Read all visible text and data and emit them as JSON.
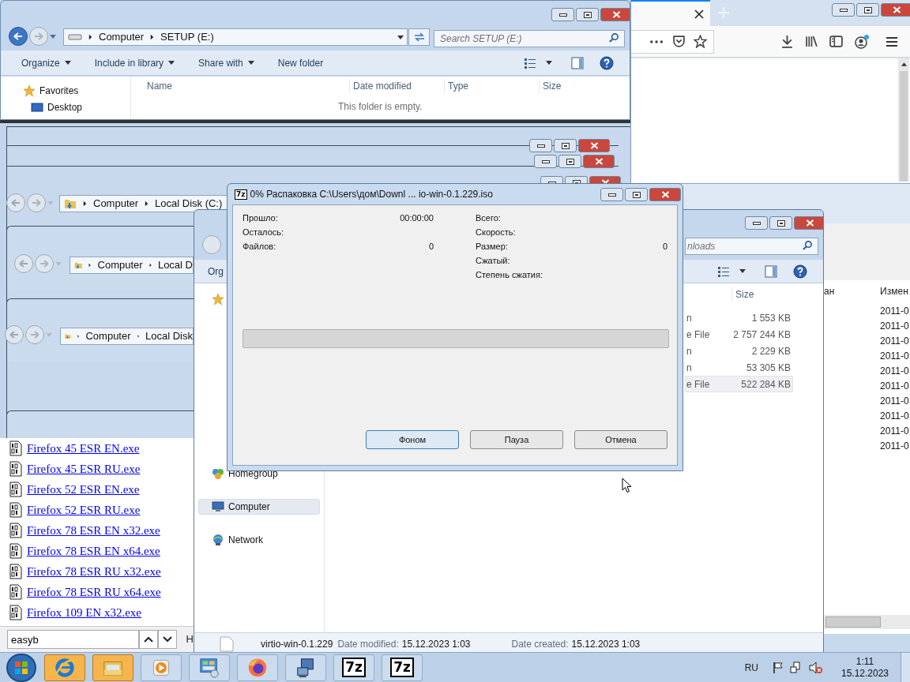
{
  "explorer_setup": {
    "address": [
      "Computer",
      "SETUP (E:)"
    ],
    "search_placeholder": "Search SETUP (E:)",
    "toolbar": [
      "Organize",
      "Include in library",
      "Share with",
      "New folder"
    ],
    "nav": [
      {
        "label": "Favorites",
        "kind": "favorites"
      },
      {
        "label": "Desktop",
        "kind": "desktop"
      }
    ],
    "columns": [
      "Name",
      "Date modified",
      "Type",
      "Size"
    ],
    "empty_message": "This folder is empty."
  },
  "ghost_windows": [
    {
      "address": [
        "Computer",
        "Local Disk (C:)"
      ]
    },
    {
      "address": [
        "Computer",
        "Local D"
      ]
    },
    {
      "address": [
        "Computer",
        "Local Disk"
      ]
    }
  ],
  "back_window": {
    "columns": [
      "ан",
      "Измен"
    ],
    "rows": [
      "2011-0",
      "2011-0",
      "2011-0",
      "2011-0",
      "2011-0",
      "2011-0",
      "2011-0",
      "2011-0",
      "2011-0",
      "2011-0"
    ]
  },
  "browser_page": {
    "links": [
      "Firefox 45 ESR EN.exe",
      "Firefox 45 ESR RU.exe",
      "Firefox 52 ESR EN.exe",
      "Firefox 52 ESR RU.exe",
      "Firefox 78 ESR EN x32.exe",
      "Firefox 78 ESR EN x64.exe",
      "Firefox 78 ESR RU x32.exe",
      "Firefox 78 ESR RU x64.exe",
      "Firefox 109 EN x32.exe"
    ],
    "find_value": "easyb",
    "column_2": "H"
  },
  "explorer_downloads": {
    "search_placeholder": "nloads",
    "toolbar": [
      "Org"
    ],
    "nav": [
      {
        "label": "Homegroup",
        "kind": "homegroup",
        "selected": false
      },
      {
        "label": "Computer",
        "kind": "computer",
        "selected": true
      },
      {
        "label": "Network",
        "kind": "network",
        "selected": false
      }
    ],
    "columns": [
      "Size"
    ],
    "rows": [
      {
        "type": "n",
        "size": "1 553 KB",
        "selected": false
      },
      {
        "type": "e File",
        "size": "2 757 244 KB",
        "selected": false
      },
      {
        "type": "n",
        "size": "2 229 KB",
        "selected": false
      },
      {
        "type": "n",
        "size": "53 305 KB",
        "selected": false
      },
      {
        "type": "e File",
        "size": "522 284 KB",
        "selected": true
      }
    ],
    "status": {
      "name": "virtio-win-0.1.229",
      "modified_label": "Date modified:",
      "modified": "15.12.2023 1:03",
      "created_label": "Date created:",
      "created": "15.12.2023 1:03"
    }
  },
  "dialog": {
    "icon_text": "7z",
    "title": "0% Распаковка C:\\Users\\дом\\Downl ... io-win-0.1.229.iso",
    "left_stats": [
      {
        "label": "Прошло:",
        "value": "00:00:00"
      },
      {
        "label": "Осталось:"
      },
      {
        "label": "Файлов:",
        "value": "0"
      }
    ],
    "right_stats": [
      {
        "label": "Всего:"
      },
      {
        "label": "Скорость:"
      },
      {
        "label": "Размер:",
        "value": "0"
      },
      {
        "label": "Сжатый:"
      },
      {
        "label": "Степень сжатия:"
      }
    ],
    "progress": {
      "level": 0
    },
    "buttons": [
      {
        "label": "Фоном",
        "focused": true
      },
      {
        "label": "Пауза",
        "focused": false
      },
      {
        "label": "Отмена",
        "focused": false
      }
    ]
  },
  "taskbar": {
    "apps": [
      {
        "kind": "ie",
        "highlighted": true
      },
      {
        "kind": "explorer",
        "highlighted": true
      },
      {
        "kind": "media",
        "highlighted": false
      },
      {
        "kind": "control",
        "highlighted": false
      },
      {
        "kind": "firefox",
        "highlighted": false
      },
      {
        "kind": "network",
        "highlighted": false
      },
      {
        "kind": "sevenzip",
        "label": "7z",
        "highlighted": false
      },
      {
        "kind": "sevenzip",
        "label": "7z",
        "highlighted": false
      }
    ],
    "language": "RU",
    "time": "1:11",
    "date": "15.12.2023"
  }
}
